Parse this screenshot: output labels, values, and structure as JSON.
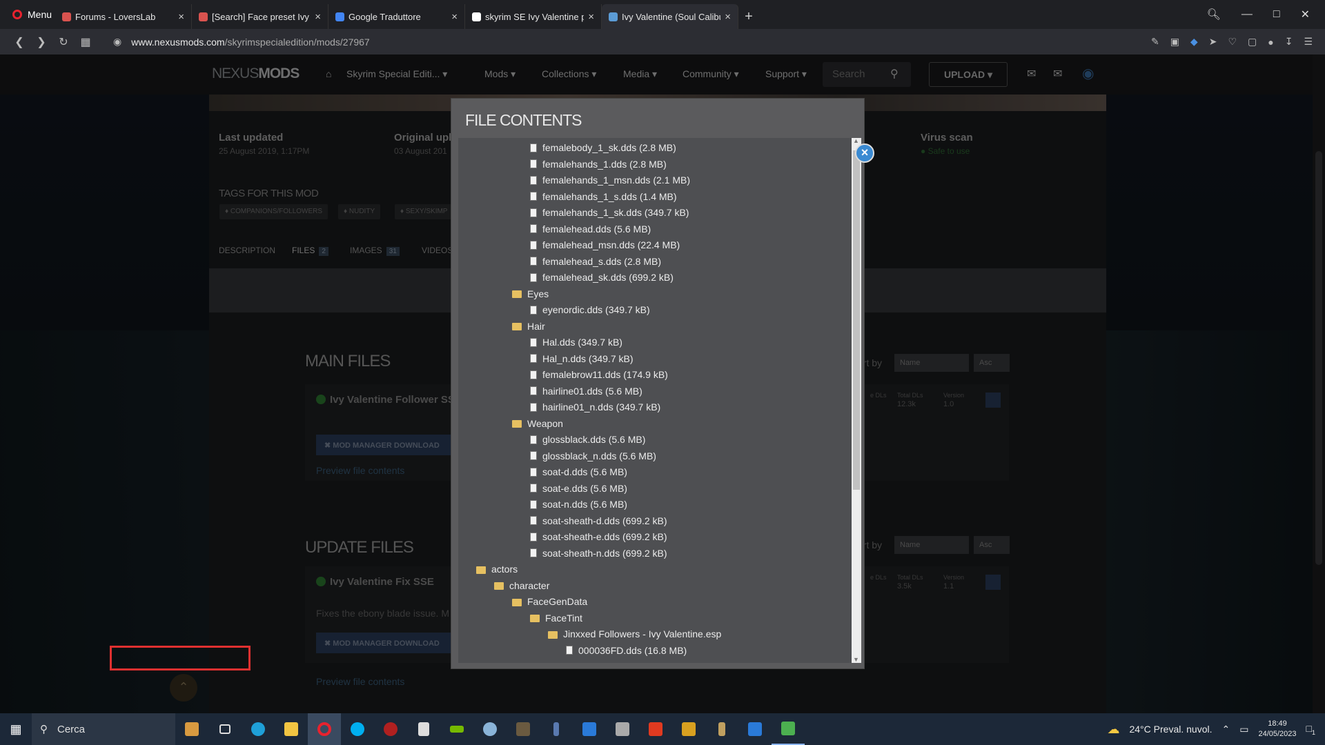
{
  "browser": {
    "menu_label": "Menu",
    "tabs": [
      {
        "title": "Forums - LoversLab",
        "color": "#d9534f"
      },
      {
        "title": "[Search] Face preset Ivy Val",
        "color": "#d9534f"
      },
      {
        "title": "Google Traduttore",
        "color": "#4285f4"
      },
      {
        "title": "skyrim SE Ivy Valentine pre",
        "color": "#ffffff"
      },
      {
        "title": "Ivy Valentine (Soul Calibur",
        "color": "#5b9bd5"
      }
    ],
    "new_tab": "+",
    "url_domain": "www.nexusmods.com",
    "url_path": "/skyrimspecialedition/mods/27967"
  },
  "site": {
    "logo_a": "NEXUS",
    "logo_b": "MODS",
    "game": "Skyrim Special Editi...",
    "nav": [
      "Mods",
      "Collections",
      "Media",
      "Community",
      "Support"
    ],
    "search_placeholder": "Search",
    "upload": "UPLOAD"
  },
  "mod_page": {
    "last_updated_label": "Last updated",
    "last_updated_value": "25 August 2019, 1:17PM",
    "original_upload_label": "Original uplo",
    "original_upload_value": "03 August 201",
    "virus_scan_label": "Virus scan",
    "virus_scan_value": "Safe to use",
    "tags_title": "TAGS FOR THIS MOD",
    "tags": [
      "COMPANIONS/FOLLOWERS",
      "NUDITY",
      "SEXY/SKIMP"
    ],
    "tabs": [
      "DESCRIPTION",
      "FILES",
      "IMAGES",
      "VIDEOS"
    ],
    "files_count": "2",
    "images_count": "31",
    "main_files_title": "MAIN FILES",
    "update_files_title": "UPDATE FILES",
    "sort_by": "ort by",
    "sort_name": "Name",
    "sort_dir": "Asc",
    "main_file_name": "Ivy Valentine Follower SS",
    "main_file_stats": {
      "unique_label": "e DLs",
      "total_label": "Total DLs",
      "total": "12.3k",
      "version_label": "Version",
      "version": "1.0"
    },
    "update_file_name": "Ivy Valentine Fix SSE",
    "update_file_desc": "Fixes the ebony blade issue. M",
    "update_file_stats": {
      "unique_label": "e DLs",
      "total_label": "Total DLs",
      "total": "3.5k",
      "version_label": "Version",
      "version": "1.1"
    },
    "mod_manager_download": "MOD MANAGER DOWNLOAD",
    "preview_file_contents": "Preview file contents"
  },
  "modal": {
    "title": "FILE CONTENTS",
    "close": "×",
    "tree": [
      {
        "type": "file",
        "level": 4,
        "label": "femalebody_1_sk.dds (2.8 MB)"
      },
      {
        "type": "file",
        "level": 4,
        "label": "femalehands_1.dds (2.8 MB)"
      },
      {
        "type": "file",
        "level": 4,
        "label": "femalehands_1_msn.dds (2.1 MB)"
      },
      {
        "type": "file",
        "level": 4,
        "label": "femalehands_1_s.dds (1.4 MB)"
      },
      {
        "type": "file",
        "level": 4,
        "label": "femalehands_1_sk.dds (349.7 kB)"
      },
      {
        "type": "file",
        "level": 4,
        "label": "femalehead.dds (5.6 MB)"
      },
      {
        "type": "file",
        "level": 4,
        "label": "femalehead_msn.dds (22.4 MB)"
      },
      {
        "type": "file",
        "level": 4,
        "label": "femalehead_s.dds (2.8 MB)"
      },
      {
        "type": "file",
        "level": 4,
        "label": "femalehead_sk.dds (699.2 kB)"
      },
      {
        "type": "folder",
        "level": 3,
        "label": "Eyes"
      },
      {
        "type": "file",
        "level": 4,
        "label": "eyenordic.dds (349.7 kB)"
      },
      {
        "type": "folder",
        "level": 3,
        "label": "Hair"
      },
      {
        "type": "file",
        "level": 4,
        "label": "Hal.dds (349.7 kB)"
      },
      {
        "type": "file",
        "level": 4,
        "label": "Hal_n.dds (349.7 kB)"
      },
      {
        "type": "file",
        "level": 4,
        "label": "femalebrow11.dds (174.9 kB)"
      },
      {
        "type": "file",
        "level": 4,
        "label": "hairline01.dds (5.6 MB)"
      },
      {
        "type": "file",
        "level": 4,
        "label": "hairline01_n.dds (349.7 kB)"
      },
      {
        "type": "folder",
        "level": 3,
        "label": "Weapon"
      },
      {
        "type": "file",
        "level": 4,
        "label": "glossblack.dds (5.6 MB)"
      },
      {
        "type": "file",
        "level": 4,
        "label": "glossblack_n.dds (5.6 MB)"
      },
      {
        "type": "file",
        "level": 4,
        "label": "soat-d.dds (5.6 MB)"
      },
      {
        "type": "file",
        "level": 4,
        "label": "soat-e.dds (5.6 MB)"
      },
      {
        "type": "file",
        "level": 4,
        "label": "soat-n.dds (5.6 MB)"
      },
      {
        "type": "file",
        "level": 4,
        "label": "soat-sheath-d.dds (699.2 kB)"
      },
      {
        "type": "file",
        "level": 4,
        "label": "soat-sheath-e.dds (699.2 kB)"
      },
      {
        "type": "file",
        "level": 4,
        "label": "soat-sheath-n.dds (699.2 kB)"
      },
      {
        "type": "folder",
        "level": 1,
        "label": "actors"
      },
      {
        "type": "folder",
        "level": 2,
        "label": "character"
      },
      {
        "type": "folder",
        "level": 3,
        "label": "FaceGenData"
      },
      {
        "type": "folder",
        "level": 4,
        "label": "FaceTint"
      },
      {
        "type": "folder",
        "level": 5,
        "label": "Jinxxed Followers - Ivy Valentine.esp"
      },
      {
        "type": "file",
        "level": 6,
        "label": "000036FD.dds (16.8 MB)"
      }
    ]
  },
  "taskbar": {
    "search": "Cerca",
    "weather": "24°C  Preval. nuvol.",
    "time": "18:49",
    "date": "24/05/2023",
    "notifications": "1"
  }
}
